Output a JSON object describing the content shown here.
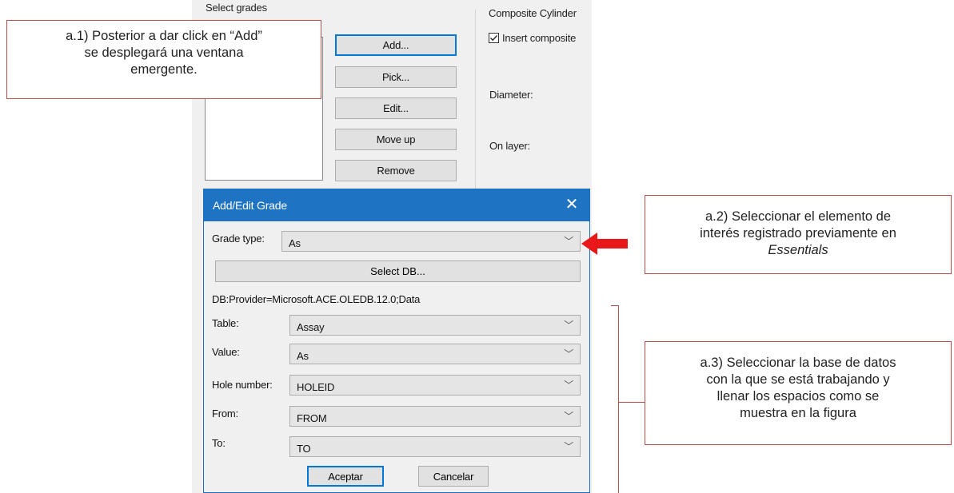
{
  "background_window": {
    "select_grades_label": "Select grades",
    "buttons": {
      "add": "Add...",
      "pick": "Pick...",
      "edit": "Edit...",
      "move_up": "Move up",
      "remove": "Remove"
    },
    "composite_label": "Composite Cylinder",
    "insert_composite_label": "Insert composite",
    "insert_composite_checked": true,
    "diameter_label": "Diameter:",
    "on_layer_label": "On layer:"
  },
  "dialog": {
    "title": "Add/Edit Grade",
    "close_glyph": "✕",
    "grade_type_label": "Grade type:",
    "grade_type_value": "As",
    "select_db_label": "Select DB...",
    "db_string": "DB:Provider=Microsoft.ACE.OLEDB.12.0;Data",
    "fields": [
      {
        "label": "Table:",
        "value": "Assay"
      },
      {
        "label": "Value:",
        "value": "As"
      },
      {
        "label": "Hole number:",
        "value": "HOLEID"
      },
      {
        "label": "From:",
        "value": "FROM"
      },
      {
        "label": "To:",
        "value": "TO"
      }
    ],
    "accept_label": "Aceptar",
    "cancel_label": "Cancelar",
    "chevron_glyph": "﹀"
  },
  "annotations": {
    "a1": {
      "line1": "a.1) Posterior a dar click en “Add”",
      "line2": "se desplegará una ventana",
      "line3": "emergente."
    },
    "a2": {
      "line1": "a.2) Seleccionar el elemento de",
      "line2": "interés registrado previamente en",
      "line3": "Essentials"
    },
    "a3": {
      "line1": "a.3) Seleccionar la base de datos",
      "line2": "con la que se está trabajando y",
      "line3": "llenar los espacios como se",
      "line4": "muestra en la figura"
    }
  },
  "colors": {
    "accent": "#0078d7",
    "titlebar": "#1f73c3",
    "callout_border": "#c0504d",
    "arrow": "#e8181a"
  }
}
